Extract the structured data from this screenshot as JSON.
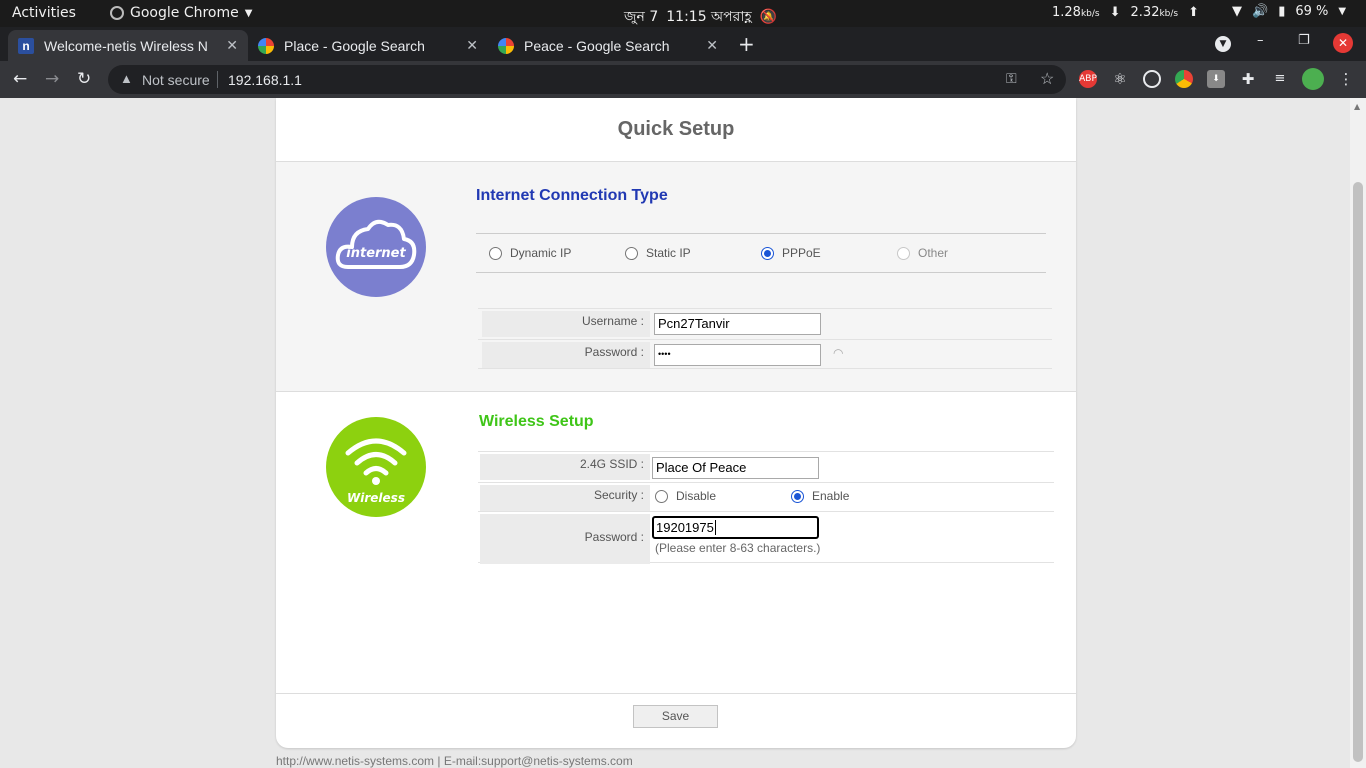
{
  "system": {
    "activities": "Activities",
    "app_name": "Google Chrome",
    "clock_date": "জুন 7",
    "clock_time": "11:15 অপরাহ্ণ",
    "down_rate": "1.28",
    "up_rate": "2.32",
    "rate_unit": "kb/s",
    "battery": "69 %"
  },
  "browser": {
    "tabs": [
      {
        "title": "Welcome-netis Wireless N",
        "icon": "netis-favicon",
        "active": true
      },
      {
        "title": "Place - Google Search",
        "icon": "google-favicon",
        "active": false
      },
      {
        "title": "Peace - Google Search",
        "icon": "google-favicon",
        "active": false
      }
    ],
    "security_label": "Not secure",
    "url": "192.168.1.1",
    "extensions": [
      "abp-icon",
      "react-icon",
      "target-icon",
      "color-icon",
      "download-icon",
      "puzzle-icon",
      "playlist-icon",
      "avatar"
    ]
  },
  "page": {
    "title": "Quick Setup",
    "internet": {
      "logo_text": "internet",
      "heading": "Internet Connection Type",
      "types": [
        {
          "label": "Dynamic IP",
          "checked": false,
          "disabled": false
        },
        {
          "label": "Static IP",
          "checked": false,
          "disabled": false
        },
        {
          "label": "PPPoE",
          "checked": true,
          "disabled": false
        },
        {
          "label": "Other",
          "checked": false,
          "disabled": true
        }
      ],
      "username_label": "Username :",
      "username_value": "Pcn27Tanvir",
      "password_label": "Password :",
      "password_value": "••••"
    },
    "wireless": {
      "logo_text": "Wireless",
      "heading": "Wireless Setup",
      "ssid_label": "2.4G SSID :",
      "ssid_value": "Place Of Peace",
      "security_label": "Security :",
      "security_disable": "Disable",
      "security_enable": "Enable",
      "security_selected": "Enable",
      "password_label": "Password :",
      "password_value": "19201975",
      "password_hint": "(Please enter 8-63 characters.)"
    },
    "save_label": "Save",
    "footer": "http://www.netis-systems.com | E-mail:support@netis-systems.com"
  },
  "colors": {
    "internet_accent": "#2139b3",
    "internet_logo": "#7b7fcf",
    "wireless_accent": "#3fc518",
    "wireless_logo": "#8dd10f"
  }
}
